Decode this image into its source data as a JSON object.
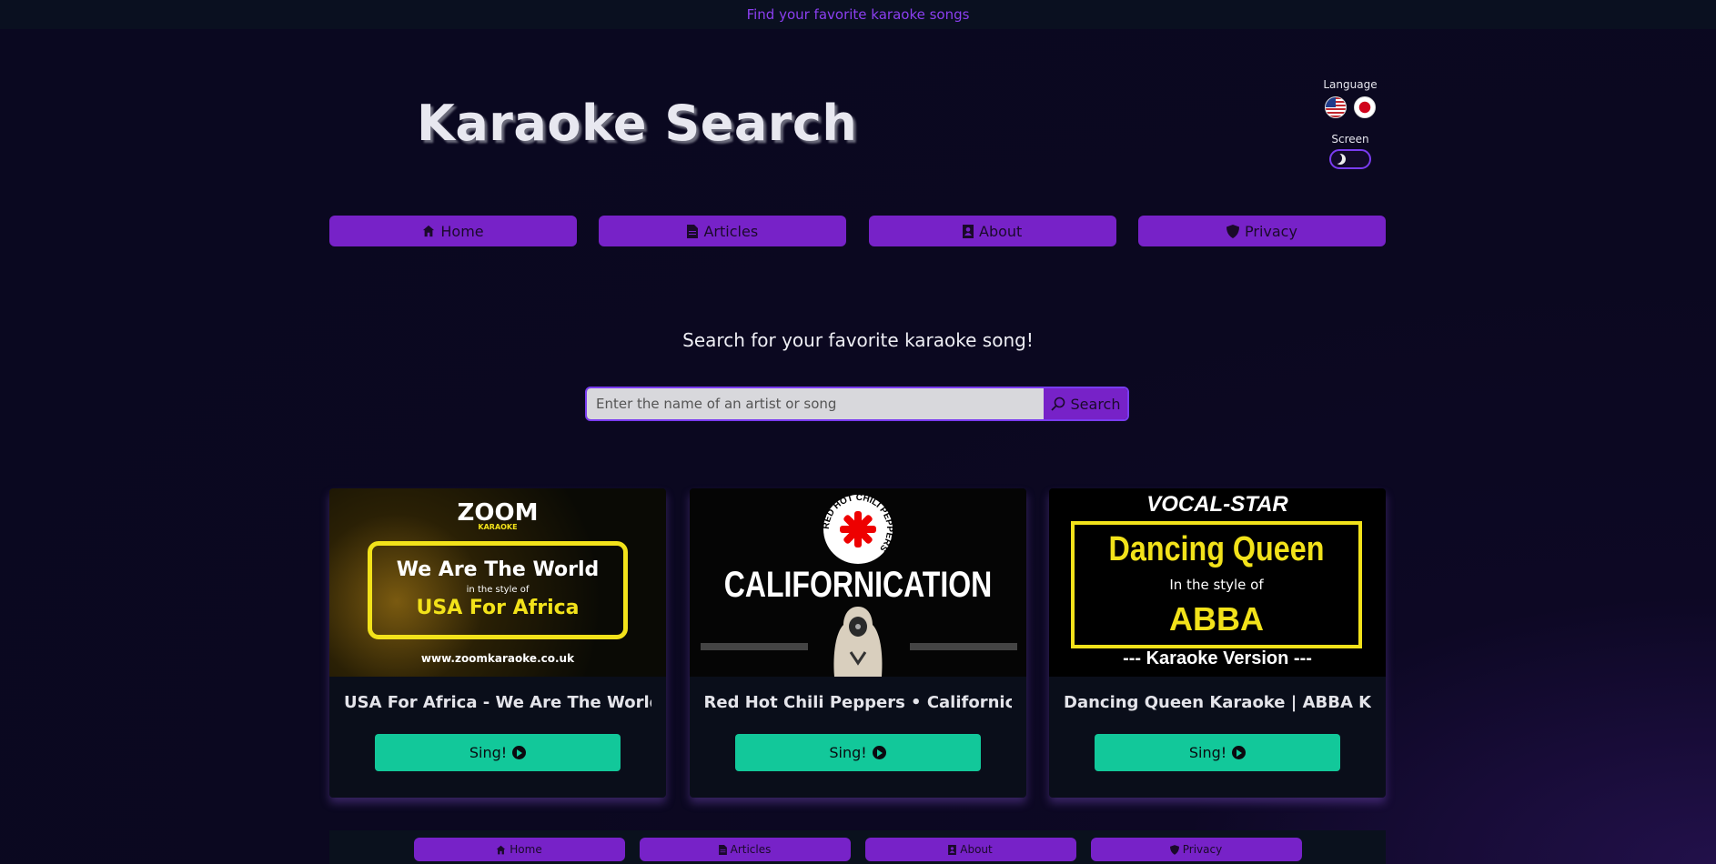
{
  "topbar": {
    "tagline": "Find your favorite karaoke songs"
  },
  "header": {
    "title": "Karaoke Search"
  },
  "settings": {
    "language_label": "Language",
    "screen_label": "Screen",
    "languages": [
      "english-flag-icon",
      "japanese-flag-icon"
    ],
    "theme_mode": "dark"
  },
  "nav": {
    "items": [
      {
        "label": "Home",
        "icon": "home-icon"
      },
      {
        "label": "Articles",
        "icon": "document-icon"
      },
      {
        "label": "About",
        "icon": "contact-icon"
      },
      {
        "label": "Privacy",
        "icon": "shield-icon"
      }
    ]
  },
  "search": {
    "heading": "Search for your favorite karaoke song!",
    "placeholder": "Enter the name of an artist or song",
    "value": "",
    "button_label": "Search"
  },
  "cards": [
    {
      "title": "USA For Africa - We Are The World - Karaoke Version from Zoom Karaoke",
      "button_label": "Sing!",
      "thumb": {
        "logo": "ZOOM",
        "logo_sub": "KARAOKE",
        "line1": "We Are The World",
        "line2": "in the style of",
        "line3": "USA For Africa",
        "url": "www.zoomkaraoke.co.uk"
      }
    },
    {
      "title": "Red Hot Chili Peppers • Californication",
      "button_label": "Sing!",
      "thumb": {
        "logo_text": "RED HOT CHILI PEPPERS",
        "line1": "CALIFORNICATION"
      }
    },
    {
      "title": "Dancing Queen Karaoke | ABBA Karaoke Version",
      "button_label": "Sing!",
      "thumb": {
        "logo": "VOCAL-STAR",
        "line1": "Dancing Queen",
        "line2": "In the style of",
        "line3": "ABBA",
        "line4": "--- Karaoke Version ---"
      }
    }
  ],
  "footer": {
    "items": [
      {
        "label": "Home",
        "icon": "home-icon"
      },
      {
        "label": "Articles",
        "icon": "document-icon"
      },
      {
        "label": "About",
        "icon": "contact-icon"
      },
      {
        "label": "Privacy",
        "icon": "shield-icon"
      }
    ]
  },
  "colors": {
    "accent": "#7722c8",
    "sing_button": "#12c89a",
    "tagline": "#8b3ff0",
    "background": "#0a0820"
  }
}
